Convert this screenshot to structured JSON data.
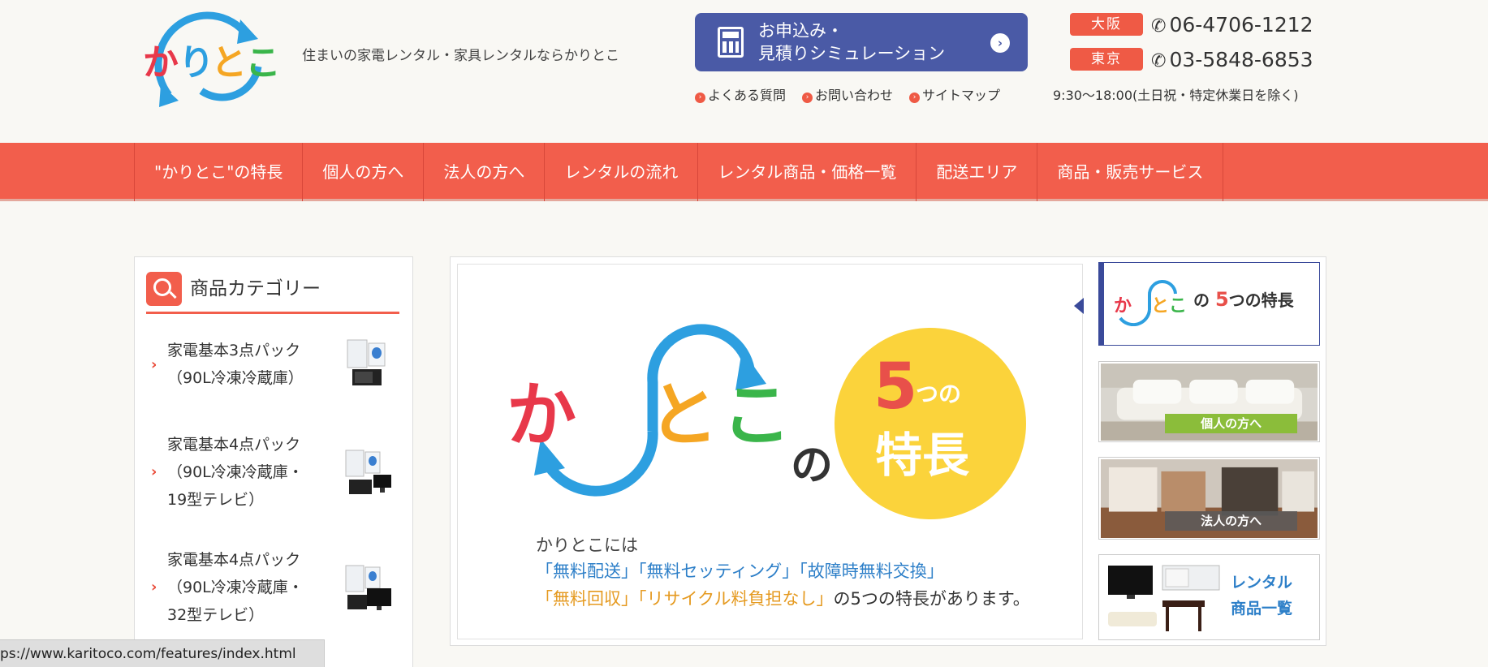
{
  "header": {
    "logo_text": "かりとこ",
    "tagline": "住まいの家電レンタル・家具レンタルならかりとこ",
    "cta_line1": "お申込み・",
    "cta_line2": "見積りシミュレーション",
    "tel": [
      {
        "city": "大阪",
        "number": "06-4706-1212"
      },
      {
        "city": "東京",
        "number": "03-5848-6853"
      }
    ],
    "sublinks": [
      "よくある質問",
      "お問い合わせ",
      "サイトマップ"
    ],
    "hours": "9:30〜18:00(土日祝・特定休業日を除く)"
  },
  "nav": {
    "items": [
      "\"かりとこ\"の特長",
      "個人の方へ",
      "法人の方へ",
      "レンタルの流れ",
      "レンタル商品・価格一覧",
      "配送エリア",
      "商品・販売サービス"
    ]
  },
  "sidebar": {
    "title": "商品カテゴリー",
    "categories": [
      {
        "line1": "家電基本3点パック",
        "line2": "（90L冷凍冷蔵庫）",
        "line3": ""
      },
      {
        "line1": "家電基本4点パック",
        "line2": "（90L冷凍冷蔵庫・",
        "line3": "19型テレビ）"
      },
      {
        "line1": "家電基本4点パック",
        "line2": "（90L冷凍冷蔵庫・",
        "line3": "32型テレビ）"
      }
    ]
  },
  "feature": {
    "no": "の",
    "five": "5",
    "tsuno": "つの",
    "tokucho": "特長",
    "desc_line1": "かりとこには",
    "desc_line2": "「無料配送」「無料セッティング」「故障時無料交換」",
    "desc_line3": "「無料回収」「リサイクル料負担なし」",
    "desc_line3_tail": "の5つの特長があります。"
  },
  "side_buttons": {
    "features_prefix": "の",
    "features_five": "5",
    "features_suffix": "つの特長",
    "personal": "個人の方へ",
    "corporate": "法人の方へ",
    "rental_line1": "レンタル",
    "rental_line2": "商品一覧"
  },
  "statusbar": {
    "url": "ps://www.karitoco.com/features/index.html"
  },
  "colors": {
    "accent": "#f25e4c",
    "cta": "#4a5aa6",
    "blue": "#2d9fe0",
    "red": "#e8384a",
    "orange": "#f5a623",
    "green": "#3ab54a",
    "yellow": "#fbd33b"
  }
}
